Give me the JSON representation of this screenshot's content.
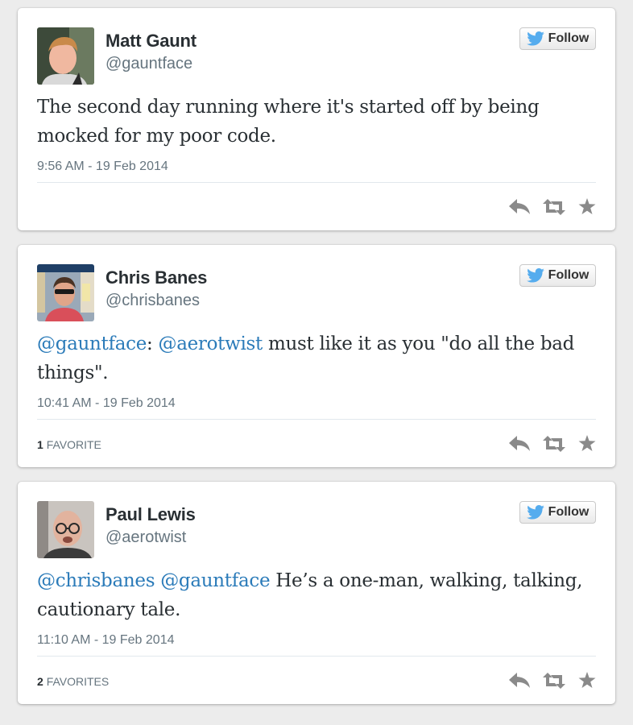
{
  "colors": {
    "background": "#ececec",
    "card": "#ffffff",
    "link": "#2b7bb9",
    "muted": "#66757f",
    "twitter_blue": "#55acee",
    "action_gray": "#8a8a8a"
  },
  "follow_label": "Follow",
  "tweets": [
    {
      "avatar_icon": "avatar-photo",
      "name": "Matt Gaunt",
      "handle": "@gauntface",
      "text_parts": [
        "The second day running where it's started off by being mocked for my poor code."
      ],
      "timestamp": "9:56 AM - 19 Feb 2014",
      "favorites_count": "",
      "favorites_label": ""
    },
    {
      "avatar_icon": "avatar-photo",
      "name": "Chris Banes",
      "handle": "@chrisbanes",
      "mention_1": "@gauntface",
      "separator_1": ": ",
      "mention_2": "@aerotwist",
      "text_rest": " must like it as you \"do all the bad things\".",
      "timestamp": "10:41 AM - 19 Feb 2014",
      "favorites_count": "1",
      "favorites_label": "FAVORITE"
    },
    {
      "avatar_icon": "avatar-photo",
      "name": "Paul Lewis",
      "handle": "@aerotwist",
      "mention_1": "@chrisbanes",
      "separator_1": " ",
      "mention_2": "@gauntface",
      "text_rest": " He’s a one-man, walking, talking, cautionary tale.",
      "timestamp": "11:10 AM - 19 Feb 2014",
      "favorites_count": "2",
      "favorites_label": "FAVORITES"
    }
  ],
  "action_icons": [
    "reply-icon",
    "retweet-icon",
    "favorite-star-icon"
  ]
}
